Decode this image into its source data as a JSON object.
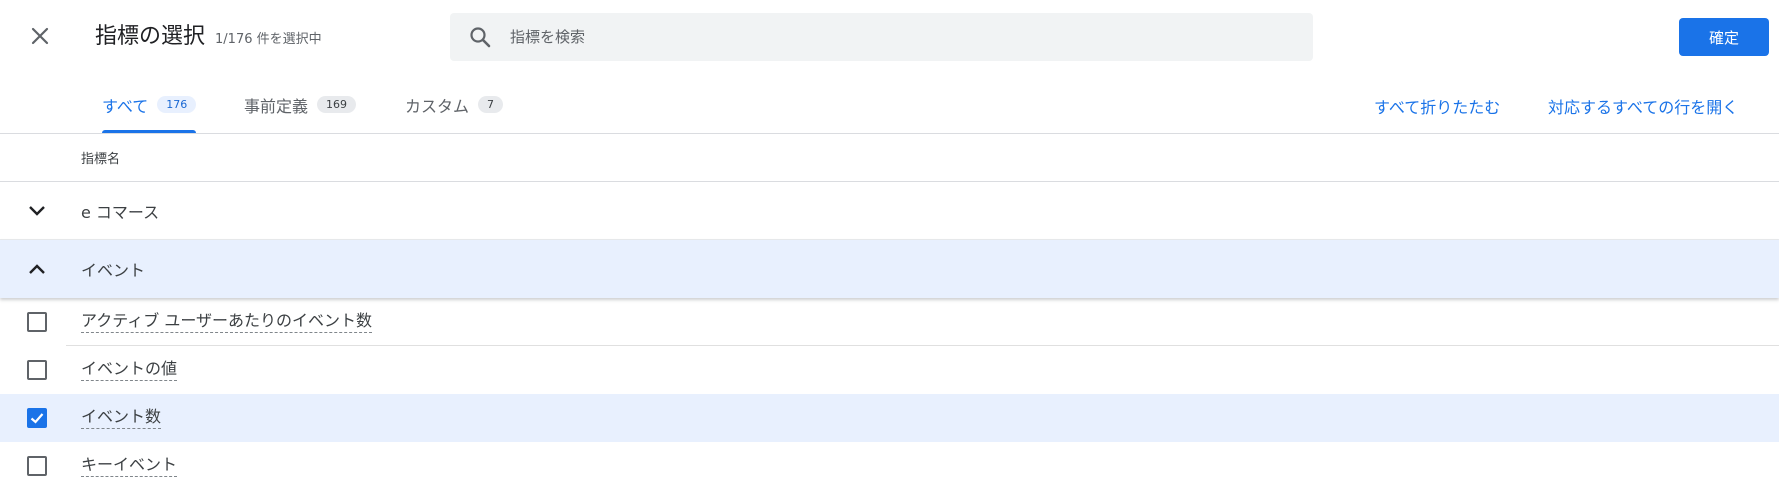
{
  "header": {
    "close_icon": "close-icon",
    "title": "指標の選択",
    "selection_count": "1/176 件を選択中",
    "search": {
      "placeholder": "指標を検索",
      "value": "",
      "icon": "search-icon"
    },
    "confirm_label": "確定"
  },
  "tabs": [
    {
      "label": "すべて",
      "count": "176",
      "active": true
    },
    {
      "label": "事前定義",
      "count": "169",
      "active": false
    },
    {
      "label": "カスタム",
      "count": "7",
      "active": false
    }
  ],
  "actions": {
    "collapse_all": "すべて折りたたむ",
    "expand_all": "対応するすべての行を開く"
  },
  "table": {
    "column_header": "指標名",
    "groups": [
      {
        "label": "e コマース",
        "expanded": false,
        "icon": "chevron-down-icon"
      },
      {
        "label": "イベント",
        "expanded": true,
        "icon": "chevron-up-icon"
      }
    ],
    "items": [
      {
        "label": "アクティブ ユーザーあたりのイベント数",
        "checked": false
      },
      {
        "label": "イベントの値",
        "checked": false
      },
      {
        "label": "イベント数",
        "checked": true
      },
      {
        "label": "キーイベント",
        "checked": false
      }
    ]
  },
  "colors": {
    "accent": "#1a73e8",
    "selected_row": "#e8f0fe",
    "search_bg": "#f1f3f4"
  }
}
